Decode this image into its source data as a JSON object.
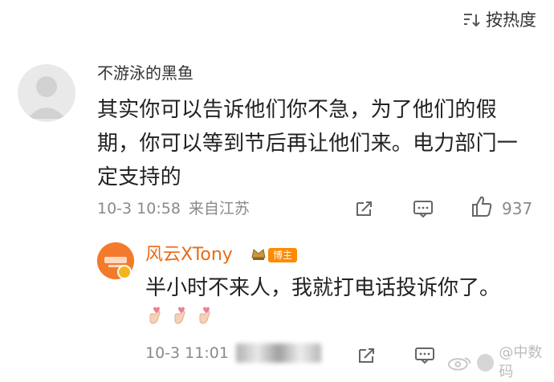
{
  "sort": {
    "label": "按热度"
  },
  "comment": {
    "username": "不游泳的黑鱼",
    "text": "其实你可以告诉他们你不急，为了他们的假期，你可以等到节后再让他们来。电力部门一定支持的",
    "time": "10-3 10:58",
    "location": "来自江苏",
    "like_count": "937",
    "icons": {
      "share": "share-icon",
      "comment": "comment-icon",
      "like": "thumbs-up-icon"
    }
  },
  "reply": {
    "username": "风云XTony",
    "badge": "博主",
    "text": "半小时不来人，我就打电话投诉你了。",
    "emoji": [
      "finger-heart-emoji",
      "finger-heart-emoji",
      "finger-heart-emoji"
    ],
    "time": "10-3 11:01",
    "watermark_text": "@中数码",
    "colors": {
      "name": "#e86b16",
      "badge": "#ff8a00"
    },
    "icons": {
      "share": "share-icon",
      "comment": "comment-icon",
      "verified": "verified-badge-icon",
      "crown": "crown-icon"
    }
  }
}
